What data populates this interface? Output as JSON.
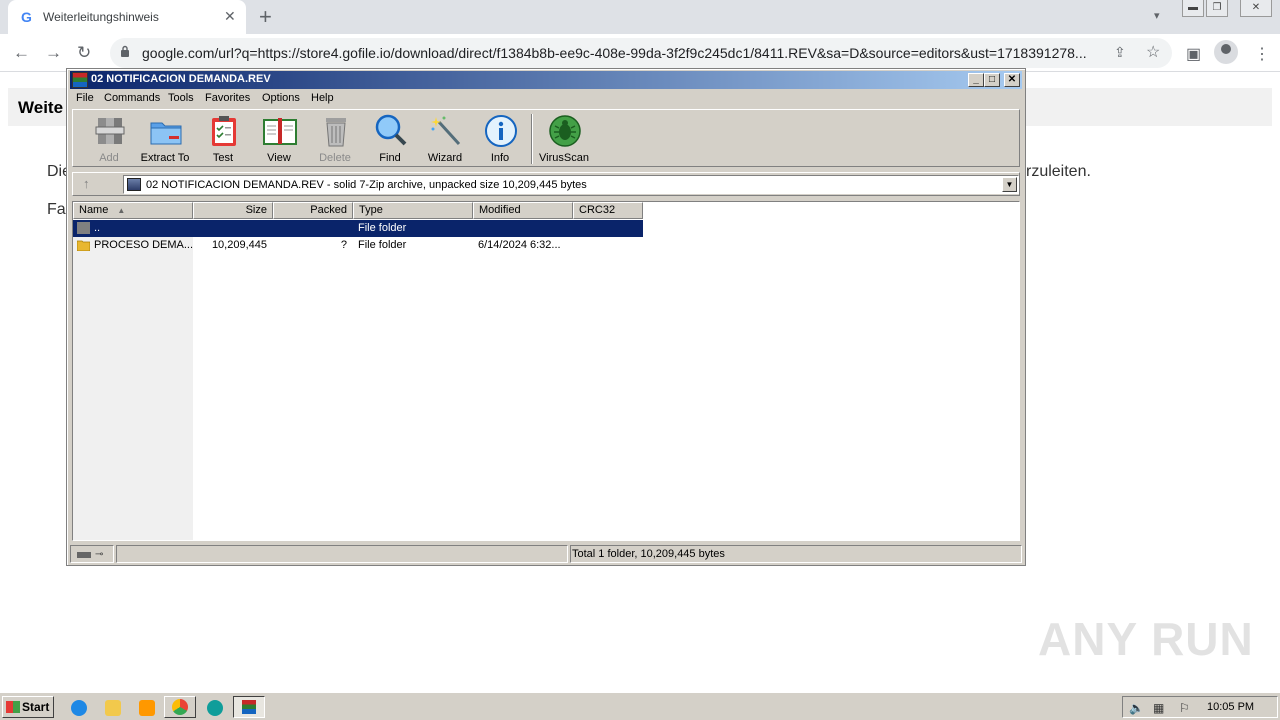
{
  "browser": {
    "tab_title": "Weiterleitungshinweis",
    "tab_favicon": "G",
    "url": "google.com/url?q=https://store4.gofile.io/download/direct/f1384b8b-ee9c-408e-99da-3f2f9c245dc1/8411.REV&sa=D&source=editors&ust=1718391278..."
  },
  "page": {
    "heading": "Weite",
    "p1_start": "Die",
    "p1_end": "rzuleiten.",
    "p2_start": "Fa"
  },
  "winrar": {
    "title": "02 NOTIFICACION DEMANDA.REV",
    "menu": [
      "File",
      "Commands",
      "Tools",
      "Favorites",
      "Options",
      "Help"
    ],
    "toolbar": [
      {
        "label": "Add",
        "icon": "add-archive-icon",
        "enabled": false
      },
      {
        "label": "Extract To",
        "icon": "extract-folder-icon",
        "enabled": true
      },
      {
        "label": "Test",
        "icon": "test-clipboard-icon",
        "enabled": true
      },
      {
        "label": "View",
        "icon": "view-book-icon",
        "enabled": true
      },
      {
        "label": "Delete",
        "icon": "trash-icon",
        "enabled": false
      },
      {
        "label": "Find",
        "icon": "magnifier-icon",
        "enabled": true
      },
      {
        "label": "Wizard",
        "icon": "wand-icon",
        "enabled": true
      },
      {
        "label": "Info",
        "icon": "info-icon",
        "enabled": true
      },
      {
        "label": "VirusScan",
        "icon": "bug-icon",
        "enabled": true
      }
    ],
    "address": "02 NOTIFICACION DEMANDA.REV - solid 7-Zip archive, unpacked size 10,209,445 bytes",
    "columns": [
      "Name",
      "Size",
      "Packed",
      "Type",
      "Modified",
      "CRC32"
    ],
    "rows": [
      {
        "name": "..",
        "size": "",
        "packed": "",
        "type": "File folder",
        "modified": "",
        "crc": "",
        "selected": true
      },
      {
        "name": "PROCESO DEMA...",
        "size": "10,209,445",
        "packed": "?",
        "type": "File folder",
        "modified": "6/14/2024 6:32...",
        "crc": "",
        "selected": false
      }
    ],
    "status": "Total 1 folder, 10,209,445 bytes"
  },
  "taskbar": {
    "start": "Start",
    "clock": "10:05 PM"
  },
  "watermark": "ANY RUN",
  "colors": {
    "selection": "#0a246a",
    "classic_face": "#d4d0c8",
    "chrome_tabbar": "#dee1e6"
  }
}
